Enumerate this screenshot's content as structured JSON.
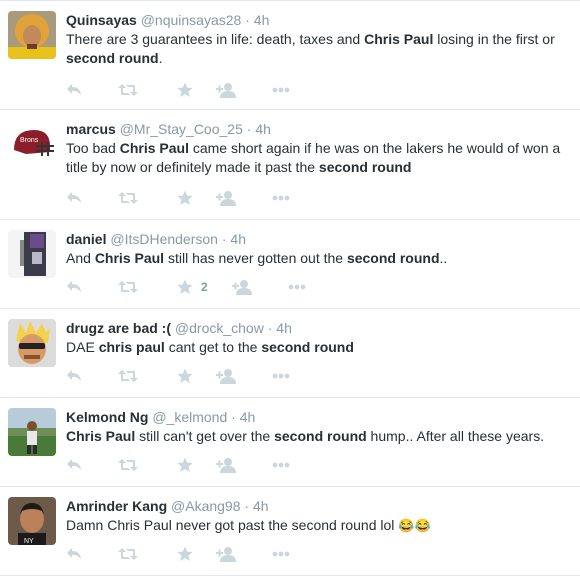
{
  "tweets": [
    {
      "name": "Quinsayas",
      "handle": "@nquinsayas28",
      "time": "4h",
      "segments": [
        {
          "t": "There are 3 guarantees in life: death, taxes and "
        },
        {
          "t": "Chris Paul",
          "b": true
        },
        {
          "t": " losing in the first or "
        },
        {
          "t": "second round",
          "b": true
        },
        {
          "t": "."
        }
      ],
      "fav_count": ""
    },
    {
      "name": "marcus",
      "handle": "@Mr_Stay_Coo_25",
      "time": "4h",
      "segments": [
        {
          "t": "Too bad "
        },
        {
          "t": "Chris Paul",
          "b": true
        },
        {
          "t": " came short again if he was on the lakers he would of won a title by now or definitely made it past the "
        },
        {
          "t": "second round",
          "b": true
        }
      ],
      "fav_count": ""
    },
    {
      "name": "daniel",
      "handle": "@ItsDHenderson",
      "time": "4h",
      "segments": [
        {
          "t": "And "
        },
        {
          "t": "Chris Paul",
          "b": true
        },
        {
          "t": " still has never gotten out the "
        },
        {
          "t": "second round",
          "b": true
        },
        {
          "t": ".."
        }
      ],
      "fav_count": "2"
    },
    {
      "name": "drugz are bad :(",
      "handle": "@drock_chow",
      "time": "4h",
      "segments": [
        {
          "t": "DAE "
        },
        {
          "t": "chris paul",
          "b": true
        },
        {
          "t": " cant get to the "
        },
        {
          "t": "second round",
          "b": true
        }
      ],
      "fav_count": ""
    },
    {
      "name": "Kelmond Ng",
      "handle": "@_kelmond",
      "time": "4h",
      "segments": [
        {
          "t": "Chris Paul",
          "b": true
        },
        {
          "t": " still can't get over the "
        },
        {
          "t": "second round",
          "b": true
        },
        {
          "t": " hump.. After all these years."
        }
      ],
      "fav_count": ""
    },
    {
      "name": "Amrinder Kang",
      "handle": "@Akang98",
      "time": "4h",
      "segments": [
        {
          "t": "Damn Chris Paul never got past the second round lol "
        },
        {
          "t": "😂😂",
          "emoji": true
        }
      ],
      "fav_count": ""
    }
  ],
  "separator": "·",
  "icons": {
    "reply": "reply-icon",
    "retweet": "retweet-icon",
    "favorite": "star-icon",
    "follow": "follow-icon",
    "more": "more-icon"
  },
  "colors": {
    "text": "#292f33",
    "meta": "#8899a6",
    "icon": "#ccd6dd",
    "border": "#e1e8ed"
  }
}
